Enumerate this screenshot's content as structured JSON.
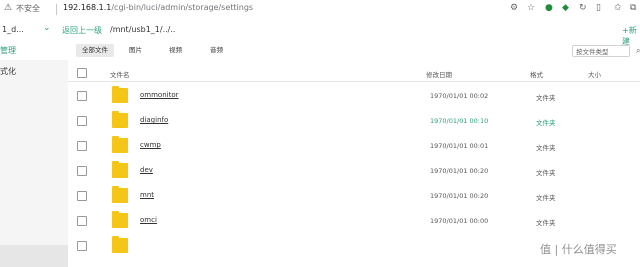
{
  "browser": {
    "security_label": "不安全",
    "url_host": "192.168.1.1",
    "url_path": "/cgi-bin/luci/admin/storage/settings"
  },
  "header": {
    "device_name": "1_d...",
    "back_link": "返回上一级",
    "path": "/mnt/usb1_1/../..",
    "new_button": "+新建"
  },
  "sidebar": {
    "items": [
      {
        "label": "管理",
        "active": true
      },
      {
        "label": "式化",
        "active": false
      }
    ]
  },
  "filters": {
    "tabs": [
      "全部文件",
      "图片",
      "视频",
      "音频"
    ],
    "active_index": 0,
    "search_placeholder": "按文件类型"
  },
  "table": {
    "columns": [
      "文件名",
      "修改日期",
      "格式",
      "大小"
    ],
    "rows": [
      {
        "name": "ommonitor",
        "date": "1970/01/01 00:02",
        "type": "文件夹",
        "highlight": false
      },
      {
        "name": "diaginfo",
        "date": "1970/01/01 00:10",
        "type": "文件夹",
        "highlight": true
      },
      {
        "name": "cwmp",
        "date": "1970/01/01 00:01",
        "type": "文件夹",
        "highlight": false
      },
      {
        "name": "dev",
        "date": "1970/01/01 00:20",
        "type": "文件夹",
        "highlight": false
      },
      {
        "name": "mnt",
        "date": "1970/01/01 00:20",
        "type": "文件夹",
        "highlight": false
      },
      {
        "name": "omci",
        "date": "1970/01/01 00:00",
        "type": "文件夹",
        "highlight": false
      }
    ]
  },
  "watermark": "值 | 什么值得买",
  "colors": {
    "accent": "#2b9f7b",
    "folder": "#f5c518",
    "sidebar_bg": "#f5f5f5"
  }
}
